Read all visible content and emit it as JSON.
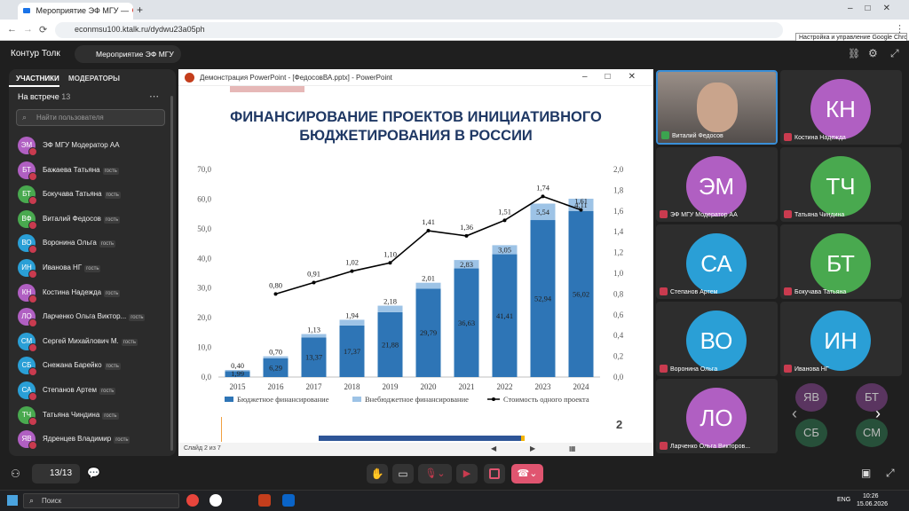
{
  "browser": {
    "tabs": [
      {
        "label": "Мероприятие ЭФ МГУ —"
      },
      {
        "label": ""
      }
    ],
    "url": "econmsu100.ktalk.ru/dydwu23a05ph",
    "tooltip": "Настройка и управление Google Chrome"
  },
  "app": {
    "name": "Контур Толк",
    "meeting_title": "Мероприятие ЭФ МГУ"
  },
  "sidebar": {
    "tabs": [
      "УЧАСТНИКИ",
      "МОДЕРАТОРЫ"
    ],
    "section_label": "На встрече",
    "count": "13",
    "search_placeholder": "Найти пользователя",
    "members": [
      {
        "initials": "ЭМ",
        "name": "ЭФ МГУ Модератор АА",
        "guest": "",
        "color": "#b05fc2"
      },
      {
        "initials": "БТ",
        "name": "Бажаева Татьяна",
        "guest": "гость",
        "color": "#b05fc2"
      },
      {
        "initials": "БТ",
        "name": "Бокучава Татьяна",
        "guest": "гость",
        "color": "#49a94f"
      },
      {
        "initials": "ВФ",
        "name": "Виталий Федосов",
        "guest": "гость",
        "color": "#49a94f"
      },
      {
        "initials": "ВО",
        "name": "Воронина Ольга",
        "guest": "гость",
        "color": "#2a9fd6"
      },
      {
        "initials": "ИН",
        "name": "Иванова НГ",
        "guest": "гость",
        "color": "#2a9fd6"
      },
      {
        "initials": "КН",
        "name": "Костина Надежда",
        "guest": "гость",
        "color": "#b05fc2"
      },
      {
        "initials": "ЛО",
        "name": "Ларченко Ольга Виктор...",
        "guest": "гость",
        "color": "#b05fc2"
      },
      {
        "initials": "СМ",
        "name": "Сергей Михайлович М.",
        "guest": "гость",
        "color": "#2a9fd6"
      },
      {
        "initials": "СБ",
        "name": "Снежана Барейко",
        "guest": "гость",
        "color": "#2a9fd6"
      },
      {
        "initials": "СА",
        "name": "Степанов Артем",
        "guest": "гость",
        "color": "#2a9fd6"
      },
      {
        "initials": "ТЧ",
        "name": "Татьяна Чиндина",
        "guest": "гость",
        "color": "#49a94f"
      },
      {
        "initials": "ЯВ",
        "name": "Ядренцев Владимир",
        "guest": "гость",
        "color": "#b05fc2"
      }
    ]
  },
  "ppt": {
    "window_title": "Демонстрация PowerPoint - [ФедосовВА.pptx] - PowerPoint",
    "slide_title_line1": "ФИНАНСИРОВАНИЕ ПРОЕКТОВ ИНИЦИАТИВНОГО",
    "slide_title_line2": "БЮДЖЕТИРОВАНИЯ В РОССИИ",
    "slide_number": "2",
    "status": "Слайд 2 из 7"
  },
  "chart_data": {
    "type": "bar",
    "categories": [
      "2015",
      "2016",
      "2017",
      "2018",
      "2019",
      "2020",
      "2021",
      "2022",
      "2023",
      "2024"
    ],
    "series": [
      {
        "name": "Бюджетное финансирование",
        "values": [
          1.99,
          6.29,
          13.37,
          17.37,
          21.88,
          29.79,
          36.63,
          41.41,
          52.94,
          56.02
        ],
        "labels": [
          "1,99",
          "6,29",
          "13,37",
          "17,37",
          "21,88",
          "29,79",
          "36,63",
          "41,41",
          "52,94",
          "56,02"
        ],
        "color": "#2e75b6"
      },
      {
        "name": "Внебюджетное финансирование",
        "values": [
          0.4,
          0.7,
          1.13,
          1.94,
          2.18,
          2.01,
          2.83,
          3.05,
          5.54,
          4.11
        ],
        "labels": [
          "0,40",
          "0,70",
          "1,13",
          "1,94",
          "2,18",
          "2,01",
          "2,83",
          "3,05",
          "5,54",
          "4,11"
        ],
        "color": "#9dc3e6"
      },
      {
        "name": "Стоимость одного проекта",
        "type": "line",
        "axis": "right",
        "x": [
          "2016",
          "2017",
          "2018",
          "2019",
          "2020",
          "2021",
          "2022",
          "2023",
          "2024"
        ],
        "values": [
          0.8,
          0.91,
          1.02,
          1.1,
          1.41,
          1.36,
          1.51,
          1.74,
          1.61
        ],
        "labels": [
          "0,80",
          "0,91",
          "1,02",
          "1,10",
          "1,41",
          "1,36",
          "1,51",
          "1,74",
          "1,61"
        ],
        "color": "#000000"
      }
    ],
    "ylim": [
      0,
      70
    ],
    "yticks": [
      "0,0",
      "10,0",
      "20,0",
      "30,0",
      "40,0",
      "50,0",
      "60,0",
      "70,0"
    ],
    "y2lim": [
      0,
      2.0
    ],
    "y2ticks": [
      "0,0",
      "0,2",
      "0,4",
      "0,6",
      "0,8",
      "1,0",
      "1,2",
      "1,4",
      "1,6",
      "1,8",
      "2,0"
    ],
    "legend": "bottom"
  },
  "tiles": [
    {
      "initials": "",
      "name": "Виталий Федосов",
      "color": "#444"
    },
    {
      "initials": "КН",
      "name": "Костина Надежда",
      "color": "#b05fc2"
    },
    {
      "initials": "ЭМ",
      "name": "ЭФ МГУ Модератор АА",
      "color": "#b05fc2"
    },
    {
      "initials": "ТЧ",
      "name": "Татьяна Чиндина",
      "color": "#49a94f"
    },
    {
      "initials": "СА",
      "name": "Степанов Артем",
      "color": "#2a9fd6"
    },
    {
      "initials": "БТ",
      "name": "Бокучава Татьяна",
      "color": "#49a94f"
    },
    {
      "initials": "ВО",
      "name": "Воронина Ольга",
      "color": "#2a9fd6"
    },
    {
      "initials": "ИН",
      "name": "Иванова НГ",
      "color": "#2a9fd6"
    },
    {
      "initials": "ЛО",
      "name": "Ларченко Ольга Викторов...",
      "color": "#b05fc2"
    }
  ],
  "overflow_avatars": [
    "ЯВ",
    "БТ",
    "СБ",
    "СМ"
  ],
  "bottom": {
    "participants_count": "13/13"
  },
  "taskbar": {
    "search_label": "Поиск",
    "lang": "ENG",
    "time": "10:26",
    "date": "15.06.2026"
  }
}
